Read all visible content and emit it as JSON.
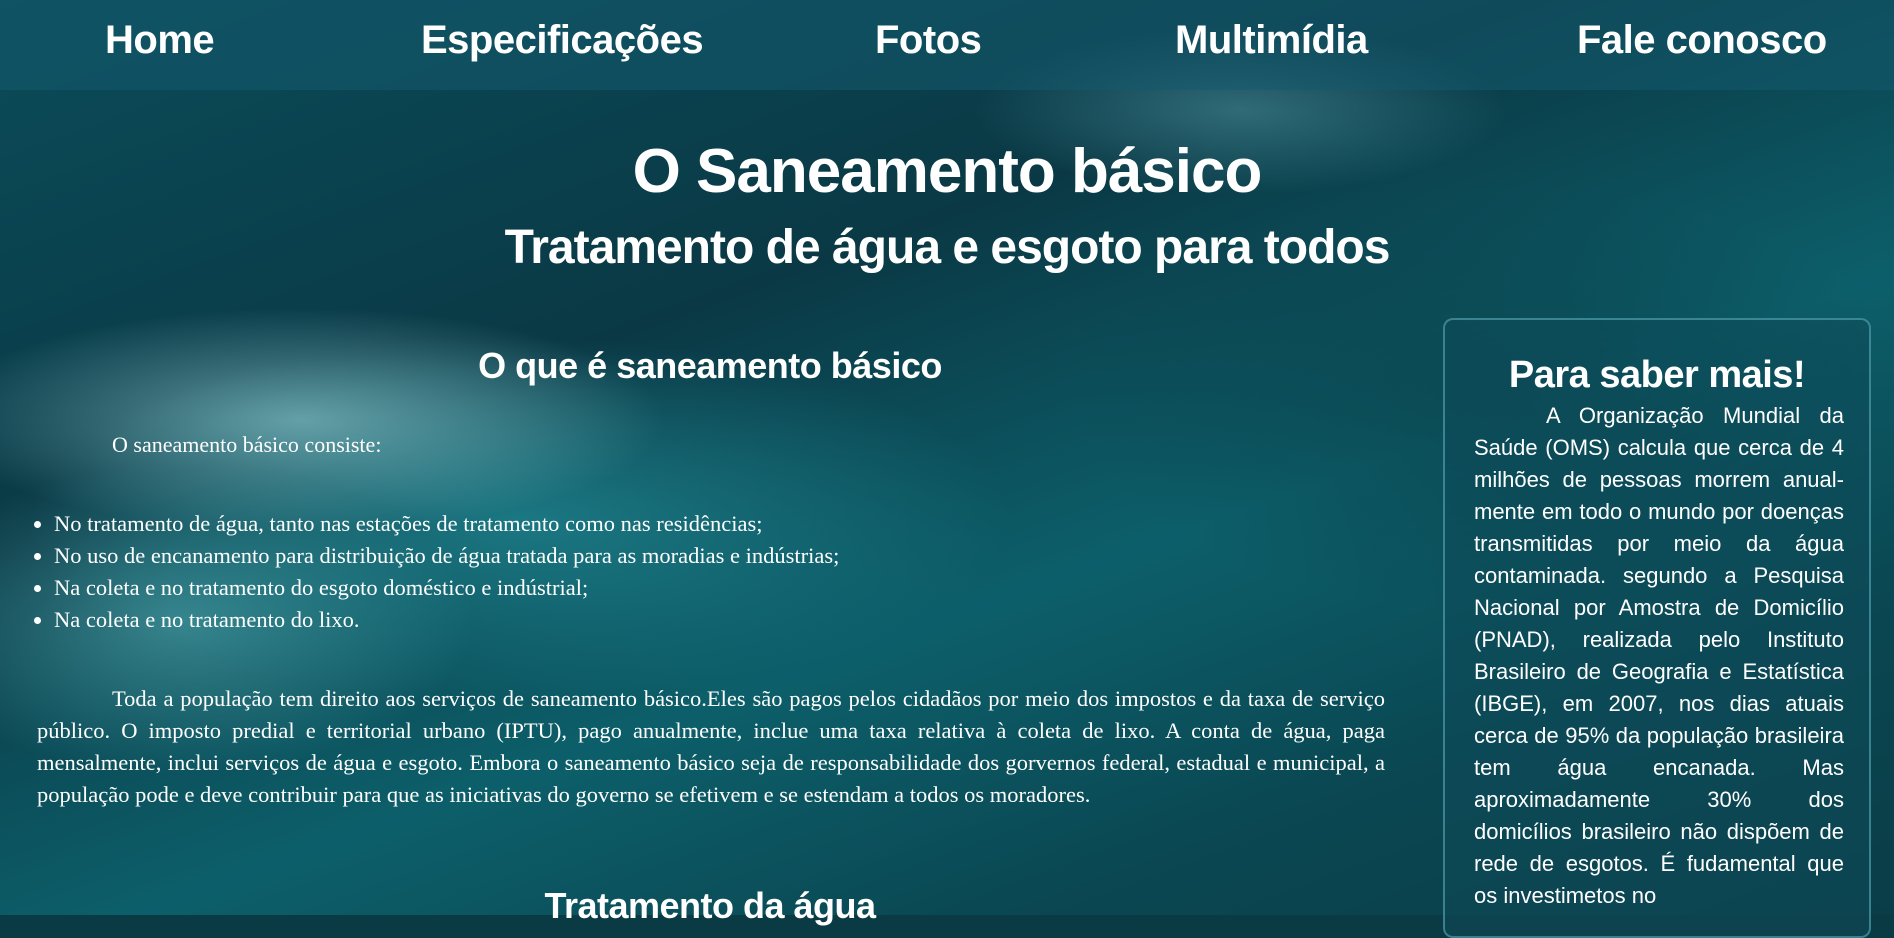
{
  "nav": {
    "items": [
      {
        "label": "Home"
      },
      {
        "label": "Especificações"
      },
      {
        "label": "Fotos"
      },
      {
        "label": "Multimídia"
      },
      {
        "label": "Fale conosco"
      }
    ]
  },
  "header": {
    "title": "O Saneamento básico",
    "subtitle": "Tratamento de água e esgoto para todos"
  },
  "main": {
    "section_heading": "O que é saneamento básico",
    "intro": "O saneamento básico consiste:",
    "bullets": [
      "No tratamento de água, tanto nas estações de tratamento como nas residências;",
      "No uso de encanamento para distribuição de água tratada para as moradias e indústrias;",
      "Na coleta e no tratamento do esgoto doméstico e indústrial;",
      "Na coleta e no tratamento do lixo."
    ],
    "paragraph": "Toda a população tem direito aos serviços de saneamento básico.Eles são pagos pelos cidadãos por meio dos impostos e da taxa de serviço público. O imposto predial e territorial urbano (IPTU), pago anualmente, inclue uma taxa relativa à coleta de lixo. A conta de água, paga mensalmente, inclui serviços de água e esgoto. Embora o saneamento básico seja de responsabilidade dos gorvernos federal, estadual e municipal, a população pode e deve contribuir para que as iniciativas do governo se efetivem e se estendam a todos os moradores.",
    "next_heading": "Tratamento da água"
  },
  "aside": {
    "title": "Para saber mais!",
    "text": "A Organização Mundial da Saúde (OMS) calcula que cerca de 4 milhões de pessoas morrem anual­mente em todo o mundo por doenças transmitidas por meio da água contaminada. segundo a Pesquisa Nacional por Amostra de Domicílio (PNAD), realizada pelo Instituto Brasileiro de Geografia e Estatística (IBGE), em 2007, nos dias atuais cerca de 95% da população brasileira tem água encanada. Mas aproximadamente 30% dos domicílios brasileiro não dispõem de rede de esgotos. É fudamental que os investimetos no"
  }
}
